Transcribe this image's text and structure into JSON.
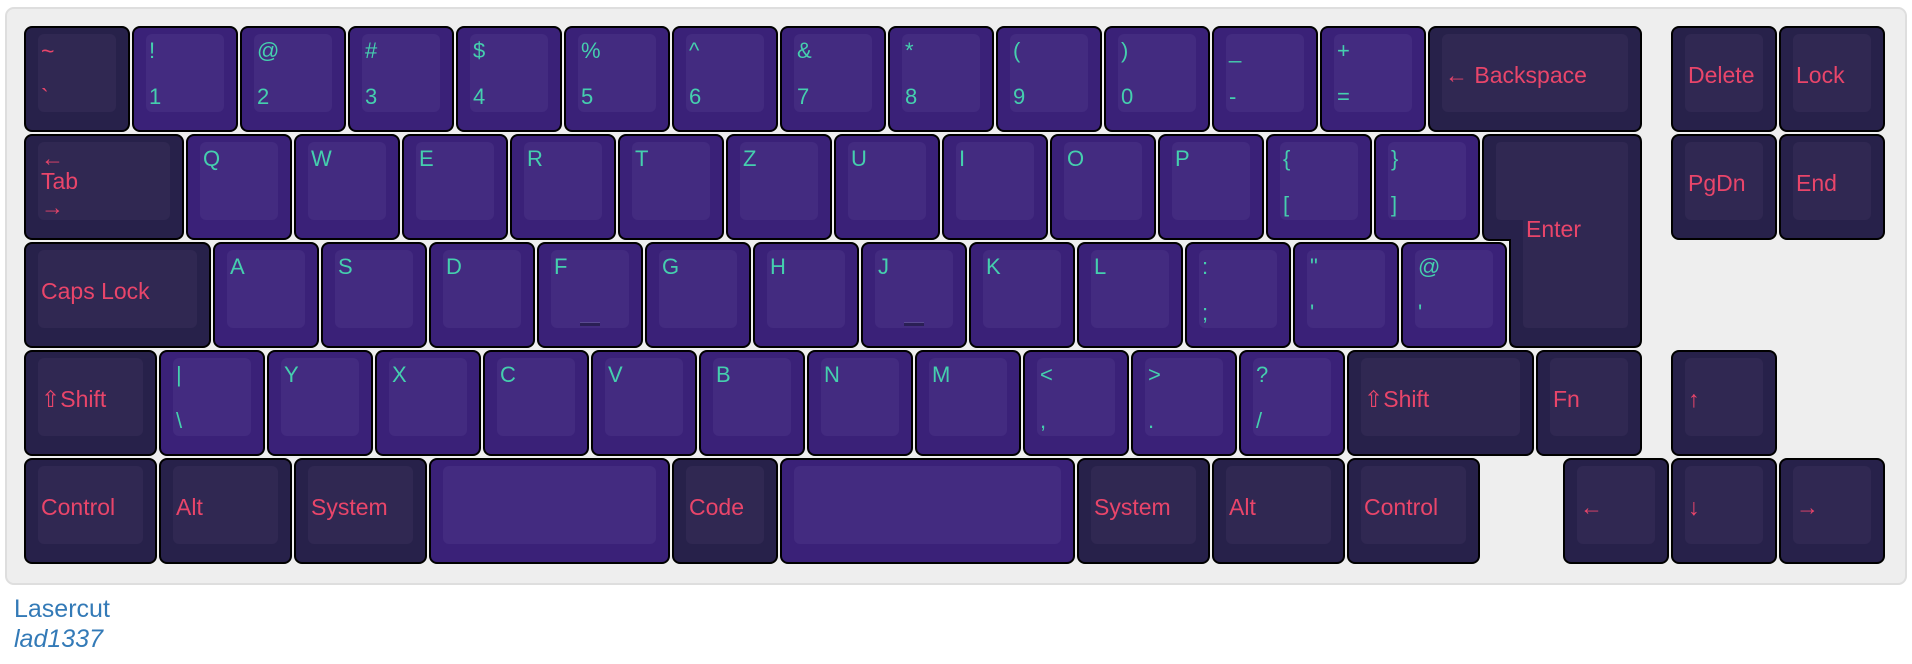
{
  "colors": {
    "frame_bg": "#eeeeee",
    "purple_key_outer": "#3a2178",
    "purple_key_inner": "#432b80",
    "dark_key_outer": "#27214a",
    "dark_key_inner": "#302852",
    "legend_teal": "#45cfae",
    "legend_red": "#e9456a",
    "caption_blue": "#337ab7"
  },
  "keyboard": {
    "rows": [
      [
        {
          "id": "grave",
          "style": "dark",
          "top": "~",
          "bottom": "`"
        },
        {
          "id": "1",
          "style": "purple",
          "top": "!",
          "bottom": "1"
        },
        {
          "id": "2",
          "style": "purple",
          "top": "@",
          "bottom": "2"
        },
        {
          "id": "3",
          "style": "purple",
          "top": "#",
          "bottom": "3"
        },
        {
          "id": "4",
          "style": "purple",
          "top": "$",
          "bottom": "4"
        },
        {
          "id": "5",
          "style": "purple",
          "top": "%",
          "bottom": "5"
        },
        {
          "id": "6",
          "style": "purple",
          "top": "^",
          "bottom": "6"
        },
        {
          "id": "7",
          "style": "purple",
          "top": "&",
          "bottom": "7"
        },
        {
          "id": "8",
          "style": "purple",
          "top": "*",
          "bottom": "8"
        },
        {
          "id": "9",
          "style": "purple",
          "top": "(",
          "bottom": "9"
        },
        {
          "id": "0",
          "style": "purple",
          "top": ")",
          "bottom": "0"
        },
        {
          "id": "minus",
          "style": "purple",
          "top": "_",
          "bottom": "-"
        },
        {
          "id": "equals",
          "style": "purple",
          "top": "+",
          "bottom": "="
        },
        {
          "id": "backspace",
          "style": "dark",
          "label": "← Backspace"
        },
        {
          "id": "delete",
          "style": "dark",
          "label": "Delete"
        },
        {
          "id": "lock",
          "style": "dark",
          "label": "Lock"
        }
      ],
      [
        {
          "id": "tab",
          "style": "dark",
          "tab_top": "←",
          "tab_mid": "Tab",
          "tab_bot": "→"
        },
        {
          "id": "q",
          "style": "purple",
          "top": "Q"
        },
        {
          "id": "w",
          "style": "purple",
          "top": "W"
        },
        {
          "id": "e",
          "style": "purple",
          "top": "E"
        },
        {
          "id": "r",
          "style": "purple",
          "top": "R"
        },
        {
          "id": "t",
          "style": "purple",
          "top": "T"
        },
        {
          "id": "z",
          "style": "purple",
          "top": "Z"
        },
        {
          "id": "u",
          "style": "purple",
          "top": "U"
        },
        {
          "id": "i",
          "style": "purple",
          "top": "I"
        },
        {
          "id": "o",
          "style": "purple",
          "top": "O"
        },
        {
          "id": "p",
          "style": "purple",
          "top": "P"
        },
        {
          "id": "lbrace",
          "style": "purple",
          "top": "{",
          "bottom": "["
        },
        {
          "id": "rbrace",
          "style": "purple",
          "top": "}",
          "bottom": "]"
        },
        {
          "id": "enter",
          "style": "dark",
          "label": "Enter"
        },
        {
          "id": "pgdn",
          "style": "dark",
          "label": "PgDn"
        },
        {
          "id": "end",
          "style": "dark",
          "label": "End"
        }
      ],
      [
        {
          "id": "capslock",
          "style": "dark",
          "label": "Caps Lock"
        },
        {
          "id": "a",
          "style": "purple",
          "top": "A"
        },
        {
          "id": "s",
          "style": "purple",
          "top": "S"
        },
        {
          "id": "d",
          "style": "purple",
          "top": "D"
        },
        {
          "id": "f",
          "style": "purple",
          "top": "F",
          "homing": true
        },
        {
          "id": "g",
          "style": "purple",
          "top": "G"
        },
        {
          "id": "h",
          "style": "purple",
          "top": "H"
        },
        {
          "id": "j",
          "style": "purple",
          "top": "J",
          "homing": true
        },
        {
          "id": "k",
          "style": "purple",
          "top": "K"
        },
        {
          "id": "l",
          "style": "purple",
          "top": "L"
        },
        {
          "id": "colon",
          "style": "purple",
          "top": ":",
          "bottom": ";"
        },
        {
          "id": "quote",
          "style": "purple",
          "top": "\"",
          "bottom": "'"
        },
        {
          "id": "at",
          "style": "purple",
          "top": "@",
          "bottom": "'"
        }
      ],
      [
        {
          "id": "lshift",
          "style": "dark",
          "label": "⇧Shift"
        },
        {
          "id": "pipe",
          "style": "purple",
          "top": "|",
          "bottom": "\\"
        },
        {
          "id": "y",
          "style": "purple",
          "top": "Y"
        },
        {
          "id": "x",
          "style": "purple",
          "top": "X"
        },
        {
          "id": "c",
          "style": "purple",
          "top": "C"
        },
        {
          "id": "v",
          "style": "purple",
          "top": "V"
        },
        {
          "id": "b",
          "style": "purple",
          "top": "B"
        },
        {
          "id": "n",
          "style": "purple",
          "top": "N"
        },
        {
          "id": "m",
          "style": "purple",
          "top": "M"
        },
        {
          "id": "comma",
          "style": "purple",
          "top": "<",
          "bottom": ","
        },
        {
          "id": "period",
          "style": "purple",
          "top": ">",
          "bottom": "."
        },
        {
          "id": "slash",
          "style": "purple",
          "top": "?",
          "bottom": "/"
        },
        {
          "id": "rshift",
          "style": "dark",
          "label": "⇧Shift"
        },
        {
          "id": "fn",
          "style": "dark",
          "label": "Fn"
        },
        {
          "id": "up",
          "style": "dark",
          "label": "↑"
        }
      ],
      [
        {
          "id": "lcontrol",
          "style": "dark",
          "label": "Control"
        },
        {
          "id": "lalt",
          "style": "dark",
          "label": "Alt"
        },
        {
          "id": "lsystem",
          "style": "dark",
          "label": "System"
        },
        {
          "id": "lspace",
          "style": "purple",
          "label": ""
        },
        {
          "id": "code",
          "style": "dark",
          "label": "Code"
        },
        {
          "id": "rspace",
          "style": "purple",
          "label": ""
        },
        {
          "id": "rsystem",
          "style": "dark",
          "label": "System"
        },
        {
          "id": "ralt",
          "style": "dark",
          "label": "Alt"
        },
        {
          "id": "rcontrol",
          "style": "dark",
          "label": "Control"
        },
        {
          "id": "left",
          "style": "dark",
          "label": "←"
        },
        {
          "id": "down",
          "style": "dark",
          "label": "↓"
        },
        {
          "id": "right",
          "style": "dark",
          "label": "→"
        }
      ]
    ]
  },
  "caption": {
    "title": "Lasercut",
    "author": "lad1337"
  }
}
